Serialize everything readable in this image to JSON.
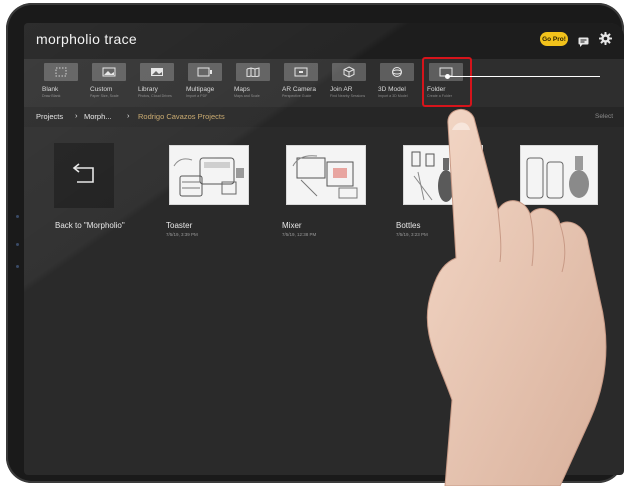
{
  "app": {
    "title": "morpholio trace",
    "go_pro": "Go Pro!"
  },
  "toolbar": {
    "items": [
      {
        "label": "Blank",
        "sub": "Draw Blank",
        "icon": "dotted-square-icon"
      },
      {
        "label": "Custom",
        "sub": "Paper Size, Scale",
        "icon": "image-sliders-icon"
      },
      {
        "label": "Library",
        "sub": "Photos, Cloud Drives",
        "icon": "photo-icon"
      },
      {
        "label": "Multipage",
        "sub": "Import a PDF",
        "icon": "pages-icon"
      },
      {
        "label": "Maps",
        "sub": "Maps and Scale",
        "icon": "map-icon"
      },
      {
        "label": "AR Camera",
        "sub": "Perspective Guide",
        "icon": "camera-icon"
      },
      {
        "label": "Join AR",
        "sub": "Find Nearby Sessions",
        "icon": "cube-icon"
      },
      {
        "label": "3D Model",
        "sub": "Import a 3D Model",
        "icon": "model-icon"
      },
      {
        "label": "Folder",
        "sub": "Create a Folder",
        "icon": "folder-icon"
      }
    ],
    "highlighted": "Folder"
  },
  "breadcrumb": {
    "items": [
      "Projects",
      "Morph...",
      "Rodrigo Cavazos Projects"
    ],
    "select_label": "Select",
    "active_color": "#c9a86b"
  },
  "projects": [
    {
      "title": "Back to \"Morpholio\"",
      "date": "",
      "kind": "back"
    },
    {
      "title": "Toaster",
      "date": "7/5/19, 3:39 PM",
      "kind": "sketch"
    },
    {
      "title": "Mixer",
      "date": "7/5/19, 12:38 PM",
      "kind": "sketch"
    },
    {
      "title": "Bottles",
      "date": "7/5/19, 3:23 PM",
      "kind": "sketch"
    },
    {
      "title": "",
      "date": "",
      "kind": "sketch"
    }
  ],
  "colors": {
    "highlight_border": "#d6141b",
    "go_pro_bg": "#f2c21b"
  }
}
